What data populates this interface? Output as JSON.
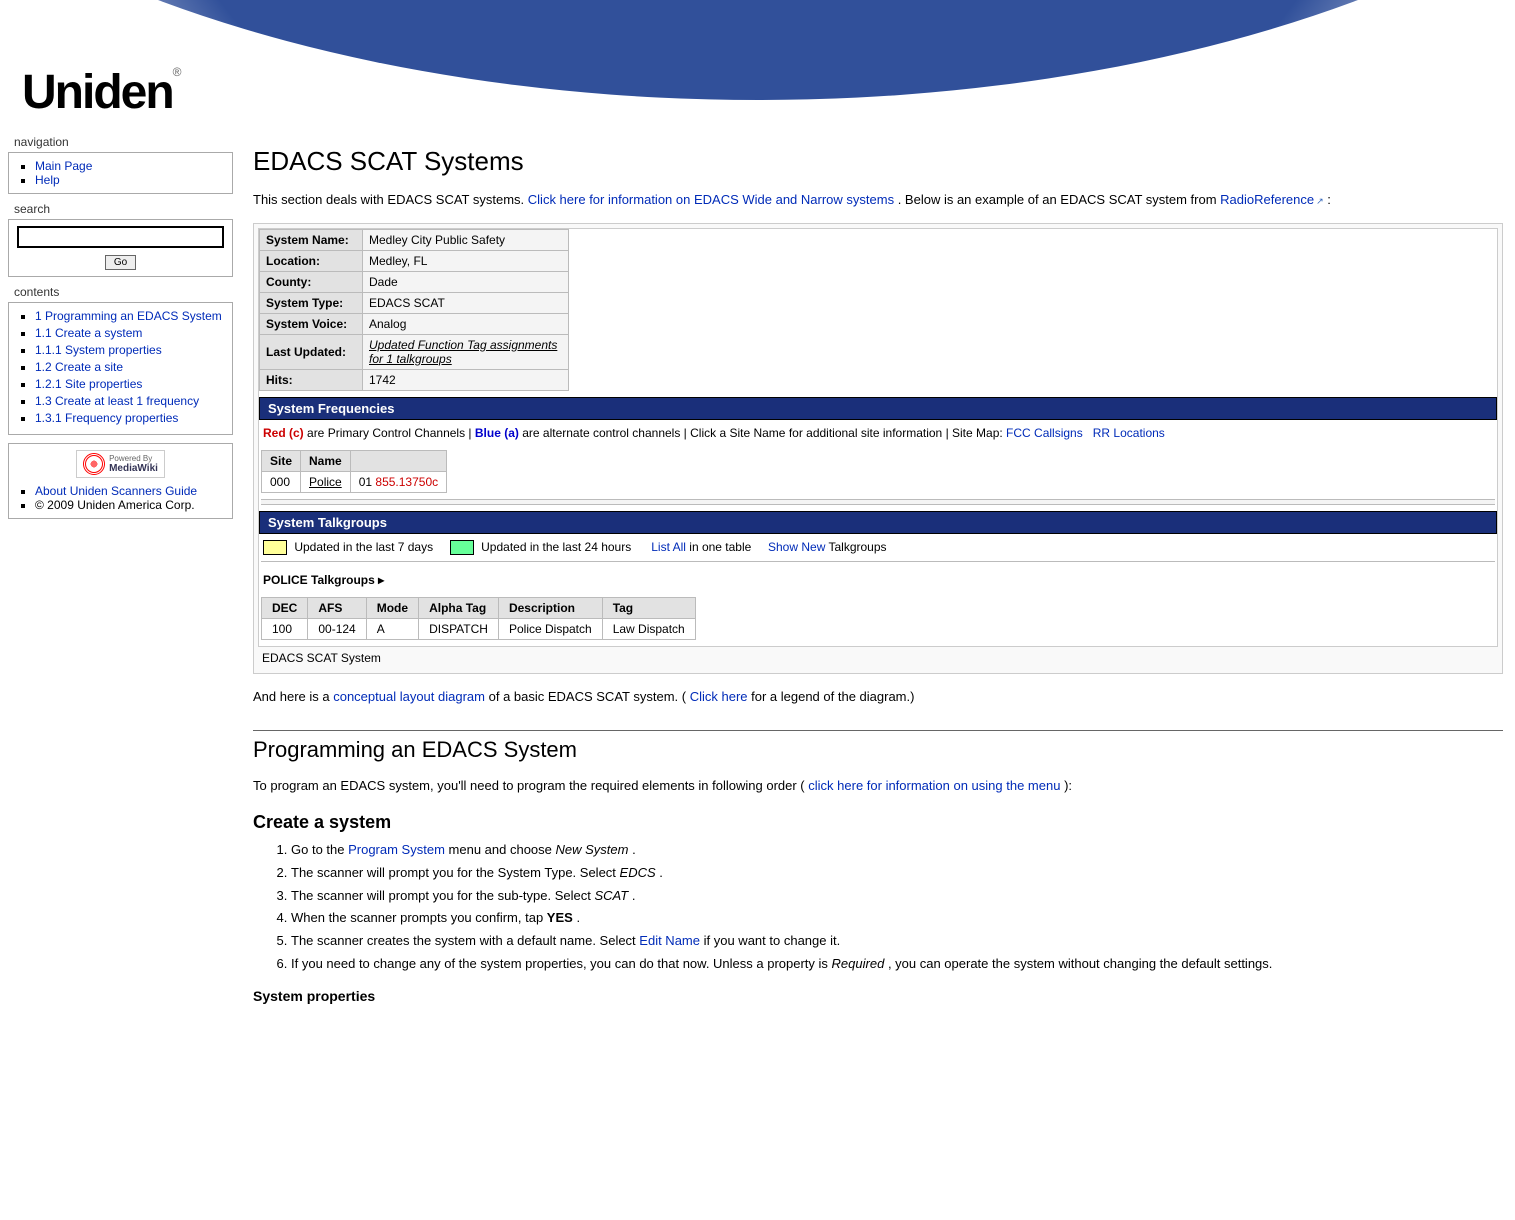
{
  "brand": "Uniden",
  "sidebar": {
    "nav_heading": "navigation",
    "nav_items": [
      "Main Page",
      "Help"
    ],
    "search_heading": "search",
    "go_label": "Go",
    "contents_heading": "contents",
    "toc": [
      "1 Programming an EDACS System",
      "1.1 Create a system",
      "1.1.1 System properties",
      "1.2 Create a site",
      "1.2.1 Site properties",
      "1.3 Create at least 1 frequency",
      "1.3.1 Frequency properties"
    ],
    "mediawiki_powered": "Powered By",
    "mediawiki_name": "MediaWiki",
    "footer_links": [
      "About Uniden Scanners Guide"
    ],
    "copyright": "© 2009 Uniden America Corp."
  },
  "article": {
    "title": "EDACS SCAT Systems",
    "intro_a": "This section deals with EDACS SCAT systems. ",
    "intro_link1": "Click here for information on EDACS Wide and Narrow systems",
    "intro_b": ". Below is an example of an EDACS SCAT system from ",
    "intro_link2": "RadioReference",
    "intro_c": " :",
    "example": {
      "rows": [
        {
          "label": "System Name:",
          "value": "Medley City Public Safety"
        },
        {
          "label": "Location:",
          "value": "Medley, FL"
        },
        {
          "label": "County:",
          "value": "Dade"
        },
        {
          "label": "System Type:",
          "value": "EDACS SCAT"
        },
        {
          "label": "System Voice:",
          "value": "Analog"
        },
        {
          "label": "Last Updated:",
          "value": "Updated Function Tag assignments for 1 talkgroups",
          "italic": true,
          "underline": true
        },
        {
          "label": "Hits:",
          "value": "1742"
        }
      ],
      "freq_bar": "System Frequencies",
      "freq_note_red": "Red (c)",
      "freq_note_1": " are Primary Control Channels | ",
      "freq_note_blue": "Blue (a)",
      "freq_note_2": " are alternate control channels | Click a Site Name for additional site information | Site Map: ",
      "freq_note_link1": "FCC Callsigns",
      "freq_note_link2": "RR Locations",
      "site_headers": [
        "Site",
        "Name",
        ""
      ],
      "site_row": {
        "site": "000",
        "name": "Police",
        "ch": "01",
        "freq": "855.13750c"
      },
      "tg_bar": "System Talkgroups",
      "legend_7d": "Updated in the last 7 days",
      "legend_24h": "Updated in the last 24 hours",
      "legend_listall_a": "List All",
      "legend_listall_b": " in one table",
      "legend_shownew_a": "Show New",
      "legend_shownew_b": " Talkgroups",
      "police_section": "POLICE Talkgroups  ▸",
      "tg_headers": [
        "DEC",
        "AFS",
        "Mode",
        "Alpha Tag",
        "Description",
        "Tag"
      ],
      "tg_row": [
        "100",
        "00-124",
        "A",
        "DISPATCH",
        "Police Dispatch",
        "Law Dispatch"
      ],
      "caption": "EDACS SCAT System"
    },
    "diagram_a": "And here is a ",
    "diagram_link1": "conceptual layout diagram",
    "diagram_b": " of a basic EDACS SCAT system. (",
    "diagram_link2": "Click here",
    "diagram_c": " for a legend of the diagram.)",
    "h2_prog": "Programming an EDACS System",
    "prog_intro_a": "To program an EDACS system, you'll need to program the required elements in following order (",
    "prog_intro_link": "click here for information on using the menu",
    "prog_intro_b": "):",
    "h3_create": "Create a system",
    "steps": [
      {
        "pre": "Go to the ",
        "link": "Program System",
        "post": " menu and choose ",
        "em": "New System",
        "post2": "."
      },
      {
        "text_a": "The scanner will prompt you for the System Type. Select ",
        "em": "EDCS",
        "text_b": "."
      },
      {
        "text_a": "The scanner will prompt you for the sub-type. Select ",
        "em": "SCAT",
        "text_b": "."
      },
      {
        "text_a": "When the scanner prompts you confirm, tap ",
        "strong": "YES",
        "text_b": "."
      },
      {
        "text_a": "The scanner creates the system with a default name. Select ",
        "link": "Edit Name",
        "text_b": " if you want to change it."
      },
      {
        "text_a": "If you need to change any of the system properties, you can do that now. Unless a property is ",
        "em": "Required",
        "text_b": ", you can operate the system without changing the default settings."
      }
    ],
    "h4_sysprops": "System properties"
  }
}
